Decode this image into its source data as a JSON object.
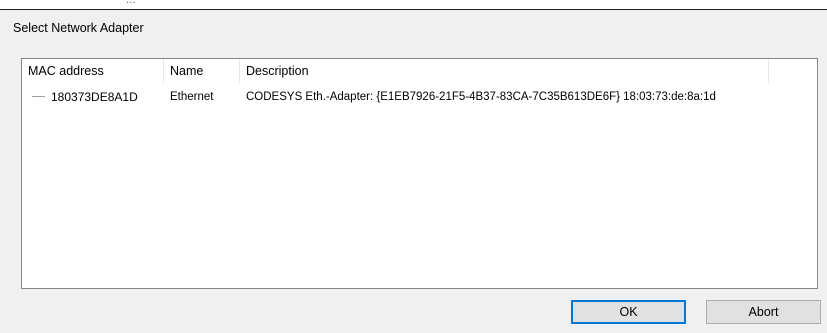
{
  "background_window": {
    "remnant_text": "..."
  },
  "dialog": {
    "title": "Select Network Adapter",
    "columns": [
      {
        "label": "MAC address"
      },
      {
        "label": "Name"
      },
      {
        "label": "Description"
      }
    ],
    "rows": [
      {
        "mac": "180373DE8A1D",
        "name": "Ethernet",
        "description": "CODESYS Eth.-Adapter: {E1EB7926-21F5-4B37-83CA-7C35B613DE6F} 18:03:73:de:8a:1d"
      }
    ],
    "buttons": {
      "ok_label": "OK",
      "abort_label": "Abort"
    }
  },
  "colors": {
    "dialog_background": "#f0f0f0",
    "list_border": "#828790",
    "button_background": "#e1e1e1",
    "default_button_border": "#0078d7"
  }
}
